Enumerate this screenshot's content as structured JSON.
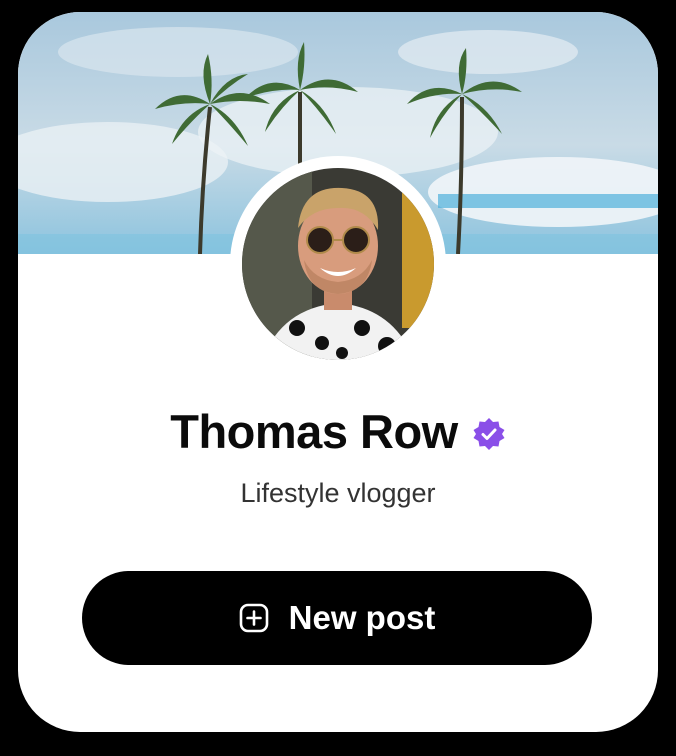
{
  "profile": {
    "name": "Thomas Row",
    "subtitle": "Lifestyle vlogger",
    "verified": true,
    "verified_color": "#8a4fe8"
  },
  "actions": {
    "new_post_label": "New post",
    "new_post_icon": "plus-square-icon"
  },
  "images": {
    "cover": "palm-trees-sky-photo",
    "avatar": "user-portrait-photo"
  }
}
